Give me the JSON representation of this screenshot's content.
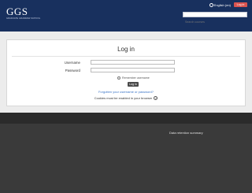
{
  "header": {
    "logo_text": "GGS",
    "logo_tagline": "GRADUATE GRAMMAR SCHOOL",
    "language": "English (en)",
    "login_button": "Log in",
    "search_placeholder": "Search courses"
  },
  "login": {
    "title": "Log in",
    "username_label": "Username",
    "password_label": "Password",
    "remember_label": "Remember username",
    "submit_label": "Log in",
    "forgot_link": "Forgotten your username or password?",
    "cookies_notice": "Cookies must be enabled in your browser"
  },
  "footer": {
    "retention_link": "Data retention summary"
  }
}
